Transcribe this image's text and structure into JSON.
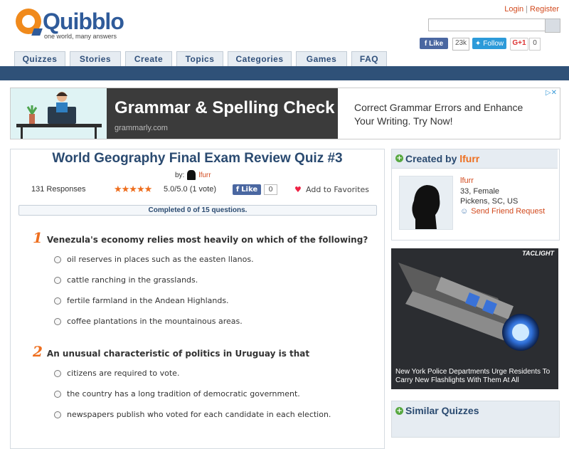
{
  "header": {
    "logo_text": "Quibblo",
    "tagline": "one world, many answers",
    "login_label": "Login",
    "register_label": "Register",
    "search_placeholder": ""
  },
  "social": {
    "fb_like_label": "Like",
    "fb_like_count": "23k",
    "twitter_label": "Follow",
    "gplus_label": "G+1",
    "gplus_count": "0"
  },
  "nav": {
    "tabs": [
      {
        "label": "Quizzes"
      },
      {
        "label": "Stories"
      },
      {
        "label": "Create"
      },
      {
        "label": "Topics"
      },
      {
        "label": "Categories"
      },
      {
        "label": "Games"
      },
      {
        "label": "FAQ"
      }
    ]
  },
  "ad_banner": {
    "title": "Grammar & Spelling Check",
    "domain": "grammarly.com",
    "body": "Correct Grammar Errors and Enhance Your Writing. Try Now!",
    "close_glyph": "▷✕"
  },
  "quiz": {
    "title": "World Geography Final Exam Review Quiz #3",
    "by_label": "by:",
    "author": "lfurr",
    "responses": "131 Responses",
    "stars": "★★★★★",
    "rating": "5.0/5.0 (1 vote)",
    "fb_like_label": "Like",
    "fb_like_count": "0",
    "favorites_label": "Add to Favorites",
    "progress_text": "Completed 0 of 15 questions.",
    "progress_fraction": 0,
    "questions": [
      {
        "number": "1",
        "text": "Venezula's economy relies most heavily on which of the following?",
        "options": [
          "oil reserves in places such as the easten llanos.",
          "cattle ranching in the grasslands.",
          "fertile farmland in the Andean Highlands.",
          "coffee plantations in the mountainous areas."
        ]
      },
      {
        "number": "2",
        "text": "An unusual characteristic of politics in Uruguay is that",
        "options": [
          "citizens are required to vote.",
          "the country has a long tradition of democratic government.",
          "newspapers publish who voted for each candidate in each election."
        ]
      }
    ]
  },
  "creator": {
    "heading_prefix": "Created by",
    "name": "lfurr",
    "profile_name": "lfurr",
    "age_gender": "33, Female",
    "location": "Pickens, SC, US",
    "friend_request": "Send Friend Request"
  },
  "side_ad": {
    "brand": "TACLIGHT",
    "caption": "New York Police Departments Urge Residents To Carry New Flashlights With Them At All"
  },
  "similar": {
    "title": "Similar Quizzes"
  },
  "colors": {
    "brand_blue": "#2f5b9a",
    "accent_orange": "#ee6e1e",
    "navbar": "#2f5178"
  }
}
